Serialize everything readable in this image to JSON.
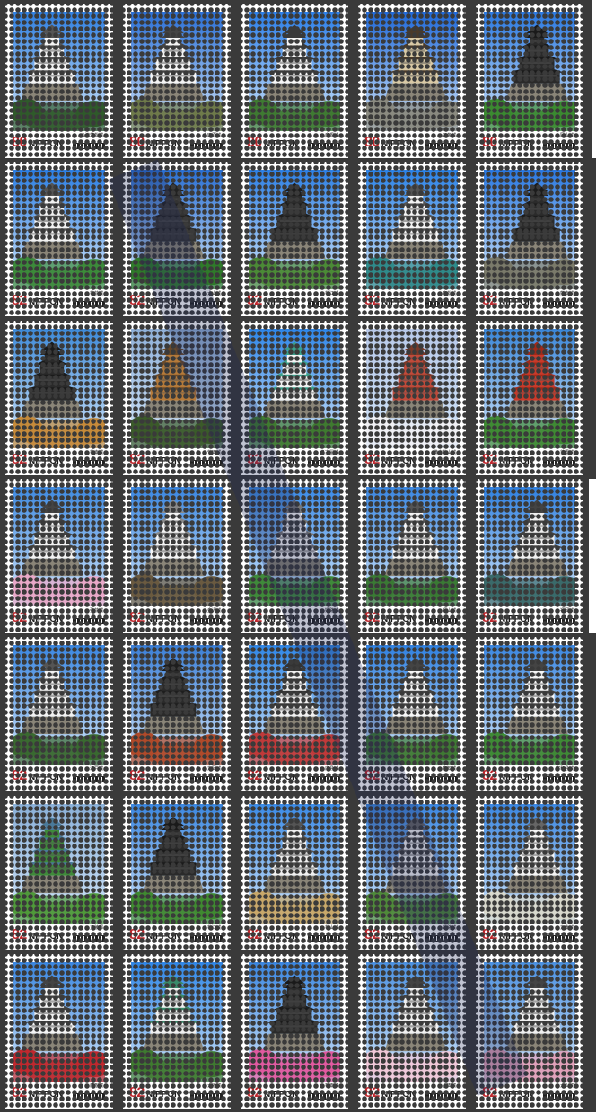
{
  "sheet_label": "",
  "stamps": [
    {
      "denom": "80",
      "brand": "NIPPON",
      "caption": "会津若松城",
      "sky": "#2f7fe0",
      "wall": "#f4f4f4",
      "roof": "#555",
      "ground": "#2f5a2a"
    },
    {
      "denom": "80",
      "brand": "NIPPON",
      "caption": "小田原城",
      "sky": "#2a6fd6",
      "wall": "#f4f4f4",
      "roof": "#444",
      "ground": "#6e7a4a"
    },
    {
      "denom": "80",
      "brand": "NIPPON",
      "caption": "彦根城",
      "sky": "#2b7ee8",
      "wall": "#f6f6f6",
      "roof": "#3a3a3a",
      "ground": "#3f7a32"
    },
    {
      "denom": "80",
      "brand": "NIPPON",
      "caption": "二条城",
      "sky": "#1f68d8",
      "wall": "#d9c9a5",
      "roof": "#4a3a2a",
      "ground": "#8a8a80"
    },
    {
      "denom": "80",
      "brand": "NIPPON",
      "caption": "岡山城",
      "sky": "#2a78e0",
      "wall": "#2a2a2a",
      "roof": "#1a1a1a",
      "ground": "#3b8a30"
    },
    {
      "denom": "82",
      "brand": "NIPPON",
      "caption": "松前城",
      "sky": "#2c7ee2",
      "wall": "#f2f2f2",
      "roof": "#555",
      "ground": "#3c8a3a"
    },
    {
      "denom": "82",
      "brand": "NIPPON",
      "caption": "犬山城",
      "sky": "#2a6fd2",
      "wall": "#333",
      "roof": "#222",
      "ground": "#2f7a2a"
    },
    {
      "denom": "82",
      "brand": "NIPPON",
      "caption": "松江城",
      "sky": "#2d7fe4",
      "wall": "#2c2c2c",
      "roof": "#1e1e1e",
      "ground": "#4b8a36"
    },
    {
      "denom": "82",
      "brand": "NIPPON",
      "caption": "高松城",
      "sky": "#2b82e6",
      "wall": "#f3f3f3",
      "roof": "#555",
      "ground": "#2f8a8a"
    },
    {
      "denom": "82",
      "brand": "NIPPON",
      "caption": "熊本城",
      "sky": "#2a78e0",
      "wall": "#2b2b2b",
      "roof": "#1c1c1c",
      "ground": "#7a7a6a"
    },
    {
      "denom": "82",
      "brand": "NIPPON",
      "caption": "松本城",
      "sky": "#3e8ad8",
      "wall": "#2a2a2a",
      "roof": "#1a1a1a",
      "ground": "#c58a3a"
    },
    {
      "denom": "82",
      "brand": "NIPPON",
      "caption": "竹田城",
      "sky": "#8fb0d8",
      "wall": "#b57a3a",
      "roof": "#6a4a2a",
      "ground": "#3b5a2a"
    },
    {
      "denom": "82",
      "brand": "NIPPON",
      "caption": "名古屋城",
      "sky": "#2e86e8",
      "wall": "#f2f2f2",
      "roof": "#3aa08a",
      "ground": "#3f7a30"
    },
    {
      "denom": "82",
      "brand": "NIPPON",
      "caption": "備中松山城",
      "sky": "#b7c8e8",
      "wall": "#c04a3a",
      "roof": "#7a3a2a",
      "ground": "#f0f0f4"
    },
    {
      "denom": "82",
      "brand": "NIPPON",
      "caption": "首里城",
      "sky": "#3a86d8",
      "wall": "#c83a2a",
      "roof": "#a02a1a",
      "ground": "#3f8a34"
    },
    {
      "denom": "82",
      "brand": "NIPPON",
      "caption": "弘前城",
      "sky": "#3f8ae0",
      "wall": "#f2f2f2",
      "roof": "#444",
      "ground": "#e8a8c8"
    },
    {
      "denom": "82",
      "brand": "NIPPON",
      "caption": "金沢城",
      "sky": "#3a86e0",
      "wall": "#f4f4f4",
      "roof": "#8a8a8a",
      "ground": "#6a5a40"
    },
    {
      "denom": "82",
      "brand": "NIPPON",
      "caption": "姫路城",
      "sky": "#3a8ae6",
      "wall": "#f8f8f8",
      "roof": "#777",
      "ground": "#3f8a3a"
    },
    {
      "denom": "82",
      "brand": "NIPPON",
      "caption": "福山城",
      "sky": "#3a86e0",
      "wall": "#f4f4f4",
      "roof": "#555",
      "ground": "#3a7a34"
    },
    {
      "denom": "82",
      "brand": "NIPPON",
      "caption": "福岡城",
      "sky": "#2f80e0",
      "wall": "#f0f0f0",
      "roof": "#444",
      "ground": "#3a6a6a"
    },
    {
      "denom": "82",
      "brand": "NIPPON",
      "caption": "江戸城",
      "sky": "#3a86e0",
      "wall": "#f2f2f2",
      "roof": "#555",
      "ground": "#3a6a30"
    },
    {
      "denom": "82",
      "brand": "NIPPON",
      "caption": "丸岡城",
      "sky": "#3a7ed6",
      "wall": "#2a2a2a",
      "roof": "#1e1e1e",
      "ground": "#b04a2a"
    },
    {
      "denom": "82",
      "brand": "NIPPON",
      "caption": "広島城",
      "sky": "#2f86e6",
      "wall": "#f0f0f0",
      "roof": "#333",
      "ground": "#c03a3a"
    },
    {
      "denom": "82",
      "brand": "NIPPON",
      "caption": "高知城",
      "sky": "#2f80e0",
      "wall": "#f6f6f6",
      "roof": "#444",
      "ground": "#3f7a34"
    },
    {
      "denom": "82",
      "brand": "NIPPON",
      "caption": "宇和島城",
      "sky": "#3a86e0",
      "wall": "#f6f6f6",
      "roof": "#444",
      "ground": "#3f8a36"
    },
    {
      "denom": "82",
      "brand": "NIPPON",
      "caption": "五稜郭",
      "sky": "#8ab0d8",
      "wall": "#3f8a3a",
      "roof": "#4a7a9a",
      "ground": "#4f9a3a"
    },
    {
      "denom": "82",
      "brand": "NIPPON",
      "caption": "松江城",
      "sky": "#3a86e0",
      "wall": "#2a2a2a",
      "roof": "#1a1a1a",
      "ground": "#3f8a30"
    },
    {
      "denom": "82",
      "brand": "NIPPON",
      "caption": "松山城",
      "sky": "#3a8ae6",
      "wall": "#f0f0f0",
      "roof": "#555",
      "ground": "#c8a86a"
    },
    {
      "denom": "82",
      "brand": "NIPPON",
      "caption": "姫路城",
      "sky": "#3a86e0",
      "wall": "#f4f4f4",
      "roof": "#666",
      "ground": "#4f8a3a"
    },
    {
      "denom": "82",
      "brand": "NIPPON",
      "caption": "丸亀城",
      "sky": "#3a86e0",
      "wall": "#f4f4f4",
      "roof": "#666",
      "ground": "#d8d8cc"
    },
    {
      "denom": "82",
      "brand": "NIPPON",
      "caption": "彦根城",
      "sky": "#3a86e0",
      "wall": "#f4f4f4",
      "roof": "#444",
      "ground": "#c0282e"
    },
    {
      "denom": "82",
      "brand": "NIPPON",
      "caption": "大阪城",
      "sky": "#2f86e6",
      "wall": "#f0f0f0",
      "roof": "#3a8a6a",
      "ground": "#3f7a30"
    },
    {
      "denom": "82",
      "brand": "NIPPON",
      "caption": "松本城",
      "sky": "#3a86e0",
      "wall": "#2a2a2a",
      "roof": "#1a1a1a",
      "ground": "#e05aa0"
    },
    {
      "denom": "82",
      "brand": "NIPPON",
      "caption": "上田城",
      "sky": "#4a90e0",
      "wall": "#f0f0f0",
      "roof": "#444",
      "ground": "#f0c8d8"
    },
    {
      "denom": "82",
      "brand": "NIPPON",
      "caption": "犬山城",
      "sky": "#4a90e0",
      "wall": "#f0f0f0",
      "roof": "#444",
      "ground": "#e0a0b8"
    }
  ]
}
